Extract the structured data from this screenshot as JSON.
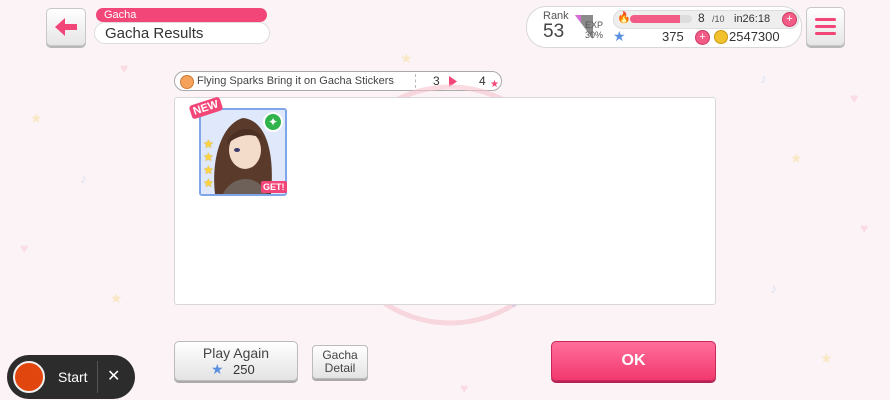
{
  "header": {
    "category": "Gacha",
    "title": "Gacha Results"
  },
  "status": {
    "rank_label": "Rank",
    "rank_value": "53",
    "exp_label": "EXP",
    "exp_percent": "30%",
    "exp_fraction": 0.3,
    "stamina_value": "8",
    "stamina_max": "/10",
    "stamina_fraction": 0.8,
    "stamina_timer": "in26:18",
    "star_gems": "375",
    "coins": "2547300"
  },
  "sticker": {
    "name": "Flying Sparks Bring it on Gacha Stickers",
    "from": "3",
    "to": "4"
  },
  "result_card": {
    "new_badge": "NEW",
    "get_badge": "GET!",
    "rarity_stars": 4
  },
  "buttons": {
    "play_again": "Play Again",
    "play_cost": "250",
    "detail_line1": "Gacha",
    "detail_line2": "Detail",
    "ok": "OK"
  },
  "recorder": {
    "start_label": "Start",
    "close_glyph": "✕"
  },
  "colors": {
    "accent": "#f24678",
    "ok_button": "#f2386f",
    "card_frame": "#7fa6e8"
  }
}
